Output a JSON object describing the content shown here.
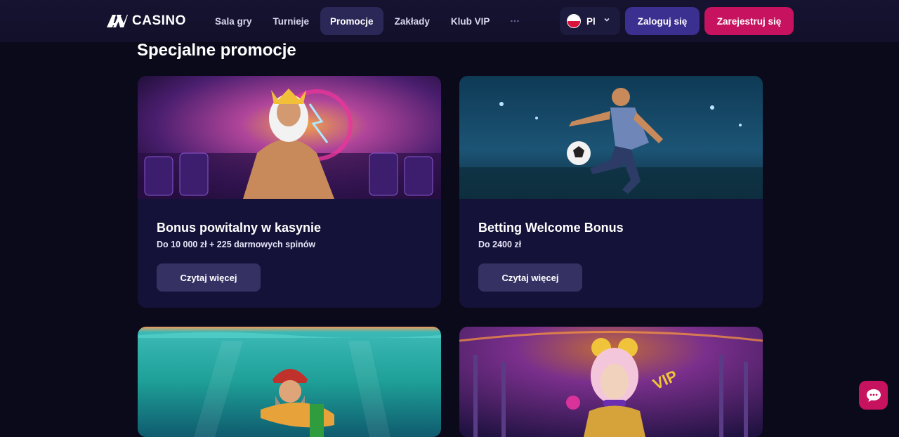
{
  "header": {
    "logo_text": "CASINO",
    "nav": [
      {
        "label": "Sala gry",
        "active": false
      },
      {
        "label": "Turnieje",
        "active": false
      },
      {
        "label": "Promocje",
        "active": true
      },
      {
        "label": "Zakłady",
        "active": false
      },
      {
        "label": "Klub VIP",
        "active": false
      }
    ],
    "more_icon": "more-dots-icon",
    "language": {
      "label": "Pl",
      "flag": "poland-flag-icon"
    },
    "login_label": "Zaloguj się",
    "register_label": "Zarejestruj się"
  },
  "main": {
    "section_title": "Specjalne promocje",
    "cards": [
      {
        "title": "Bonus powitalny w kasynie",
        "subtitle": "Do 10 000 zł + 225 darmowych spinów",
        "button": "Czytaj więcej",
        "image": "zeus-slot-art"
      },
      {
        "title": "Betting Welcome Bonus",
        "subtitle": "Do 2400 zł",
        "button": "Czytaj więcej",
        "image": "football-player-art"
      },
      {
        "image": "underwater-fisherman-art"
      },
      {
        "image": "vip-clown-girl-art"
      }
    ]
  },
  "chat": {
    "icon": "chat-bubble-icon"
  },
  "colors": {
    "background": "#0b0a1a",
    "header": "#161331",
    "card": "#141238",
    "accent_purple": "#3b2f8f",
    "accent_pink": "#c6125f",
    "card_button": "#353163"
  }
}
